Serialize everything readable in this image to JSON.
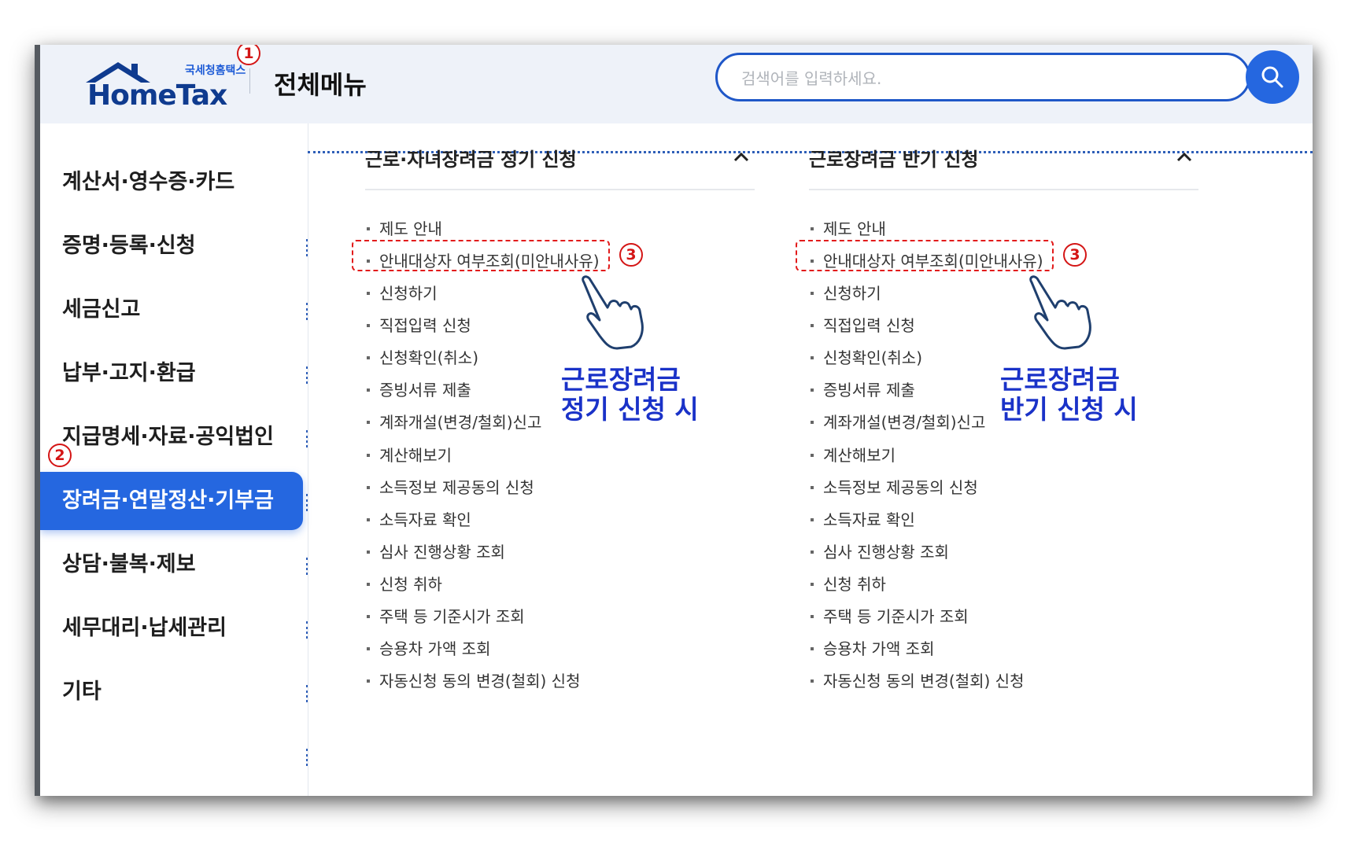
{
  "header": {
    "logo_kr": "국세청홈택스",
    "logo_en": "HomeTax",
    "title": "전체메뉴",
    "search_placeholder": "검색어를 입력하세요."
  },
  "sidebar": {
    "items": [
      {
        "label": "계산서·영수증·카드",
        "active": false
      },
      {
        "label": "증명·등록·신청",
        "active": false
      },
      {
        "label": "세금신고",
        "active": false
      },
      {
        "label": "납부·고지·환급",
        "active": false
      },
      {
        "label": "지급명세·자료·공익법인",
        "active": false
      },
      {
        "label": "장려금·연말정산·기부금",
        "active": true
      },
      {
        "label": "상담·불복·제보",
        "active": false
      },
      {
        "label": "세무대리·납세관리",
        "active": false
      },
      {
        "label": "기타",
        "active": false
      }
    ]
  },
  "panels": [
    {
      "title": "근로·자녀장려금 정기 신청",
      "items": [
        "제도 안내",
        "안내대상자 여부조회(미안내사유)",
        "신청하기",
        "직접입력 신청",
        "신청확인(취소)",
        "증빙서류 제출",
        "계좌개설(변경/철회)신고",
        "계산해보기",
        "소득정보 제공동의 신청",
        "소득자료 확인",
        "심사 진행상황 조회",
        "신청 취하",
        "주택 등 기준시가 조회",
        "승용차 가액 조회",
        "자동신청 동의 변경(철회) 신청"
      ]
    },
    {
      "title": "근로장려금 반기 신청",
      "items": [
        "제도 안내",
        "안내대상자 여부조회(미안내사유)",
        "신청하기",
        "직접입력 신청",
        "신청확인(취소)",
        "증빙서류 제출",
        "계좌개설(변경/철회)신고",
        "계산해보기",
        "소득정보 제공동의 신청",
        "소득자료 확인",
        "심사 진행상황 조회",
        "신청 취하",
        "주택 등 기준시가 조회",
        "승용차 가액 조회",
        "자동신청 동의 변경(철회) 신청"
      ]
    }
  ],
  "annotations": {
    "step1": "1",
    "step2": "2",
    "step3": "3",
    "left_line1": "근로장려금",
    "left_line2": "정기 신청 시",
    "right_line1": "근로장려금",
    "right_line2": "반기 신청 시"
  },
  "colors": {
    "accent": "#2567e0",
    "annotation_red": "#e21b1b",
    "annotation_blue": "#1a32c8",
    "header_bg": "#eef2f9"
  }
}
